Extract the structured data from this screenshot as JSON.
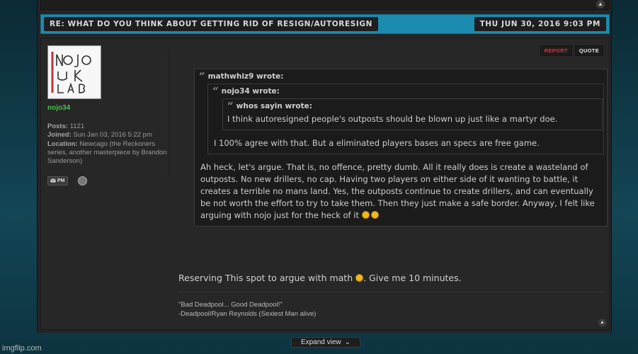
{
  "topic_header": {
    "title": "RE: WHAT DO YOU THINK ABOUT GETTING RID OF RESIGN/AUTORESIGN",
    "date": "THU JUN 30, 2016 9:03 PM"
  },
  "author": {
    "avatar_text": "NoJo LaB",
    "name": "nojo34",
    "posts_label": "Posts:",
    "posts_value": "1121",
    "joined_label": "Joined:",
    "joined_value": "Sun Jan 03, 2016 5:22 pm",
    "location_label": "Location:",
    "location_value": "Newcago (the Reckoners series, another masterpiece by Brandon Sanderson)",
    "pm_label": "PM"
  },
  "post_buttons": {
    "report": "REPORT",
    "quote": "QUOTE"
  },
  "quotes": {
    "outer_cite": "mathwhiz9 wrote:",
    "middle_cite": "nojo34 wrote:",
    "inner_cite": "whos sayin wrote:",
    "inner_text": "I think autoresigned people's outposts should be blown up just like a martyr doe.",
    "middle_text": "I 100% agree with that. But a eliminated players bases an specs are free game.",
    "outer_text": "Ah heck, let's argue. That is, no offence, pretty dumb. All it really does is create a wasteland of outposts. No new drillers, no cap. Having two players on either side of it wanting to battle, it creates a terrible no mans land. Yes, the outposts continue to create drillers, and can eventually be not worth the effort to try to take them. Then they just make a safe border. Anyway, I felt like arguing with nojo just for the heck of it"
  },
  "reply": {
    "before": "Reserving This spot to argue with math",
    "after": ". Give me 10 minutes."
  },
  "signature": {
    "line1": "\"Bad Deadpool... Good Deadpool!\"",
    "line2": "-Deadpool/Ryan Reynolds (Sexiest Man alive)"
  },
  "expand_view": {
    "label": "Expand view",
    "arrow": "⌄"
  },
  "watermark": "imgflip.com",
  "icons": {
    "up": "▲"
  },
  "colors": {
    "header_bar": "#1b8bb0",
    "username": "#46c34a",
    "report": "#e0313a"
  }
}
